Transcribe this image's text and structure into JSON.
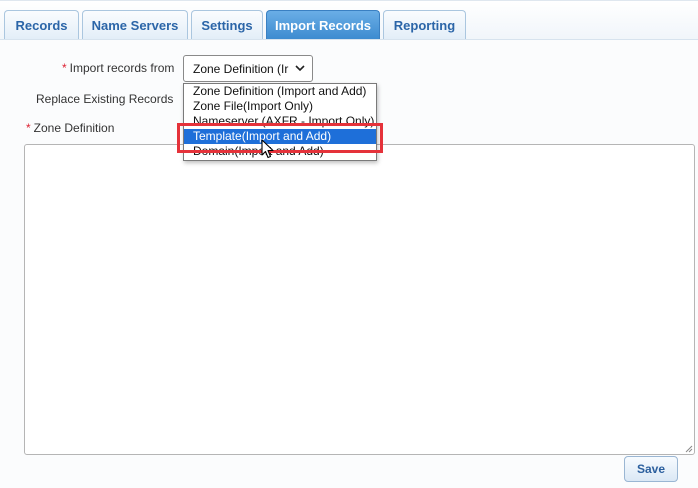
{
  "tabs": [
    {
      "label": "Records"
    },
    {
      "label": "Name Servers"
    },
    {
      "label": "Settings"
    },
    {
      "label": "Import Records"
    },
    {
      "label": "Reporting"
    }
  ],
  "active_tab": "Import Records",
  "form": {
    "import_from_label": "Import records from",
    "import_from_value": "Zone Definition (Ir",
    "replace_label": "Replace Existing Records",
    "zone_def_label": "Zone Definition",
    "required_mark": "*",
    "save_label": "Save"
  },
  "dropdown": {
    "options": [
      "Zone Definition (Import and Add)",
      "Zone File(Import Only)",
      "Nameserver (AXFR - Import Only)",
      "Template(Import and Add)",
      "Domain(Import and Add)"
    ],
    "selected_option": "Template(Import and Add)"
  },
  "colors": {
    "accent": "#3d8bd0",
    "selection": "#1e6fd9",
    "highlight": "#e5323a",
    "required": "#dd2233"
  },
  "icons": {
    "select_arrow": "chevron-down-icon",
    "pointer": "mouse-cursor-icon",
    "resize": "resize-grip-icon"
  }
}
